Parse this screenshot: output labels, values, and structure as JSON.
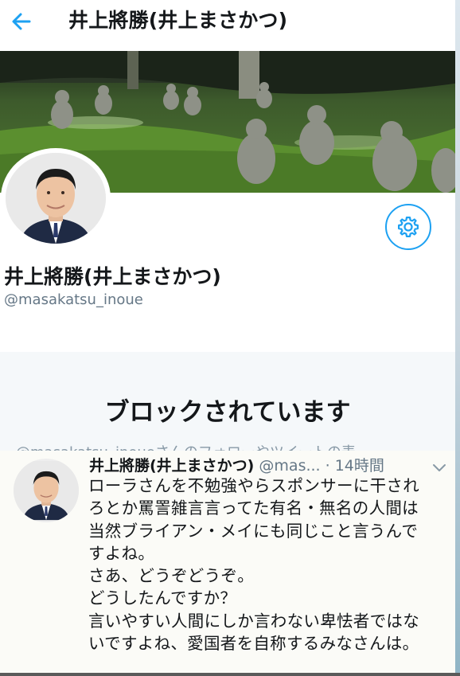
{
  "header": {
    "title": "井上將勝(井上まさかつ)"
  },
  "profile": {
    "name": "井上將勝(井上まさかつ)",
    "handle": "@masakatsu_inoue"
  },
  "blocked": {
    "title": "ブロックされています",
    "description": "@masakatsu_inoueさんのフォローやツイートの表"
  },
  "tweet": {
    "author_name": "井上將勝(井上まさかつ)",
    "meta": " @mas... · 14時間",
    "lines": [
      "ローラさんを不勉強やらスポンサーに干され",
      "ろとか罵詈雑言言ってた有名・無名の人間は",
      "当然ブライアン・メイにも同じこと言うんで",
      "すよね。",
      "さあ、どうぞどうぞ。",
      "どうしたんですか？",
      "言いやすい人間にしか言わない卑怯者ではな",
      "いですよね、愛国者を自称するみなさんは。"
    ]
  },
  "colors": {
    "accent": "#1da1f2",
    "muted": "#657786",
    "block_bg": "#f5f8fa"
  },
  "icons": {
    "back": "arrow-left-icon",
    "settings": "gear-icon",
    "caret": "chevron-down-icon"
  }
}
